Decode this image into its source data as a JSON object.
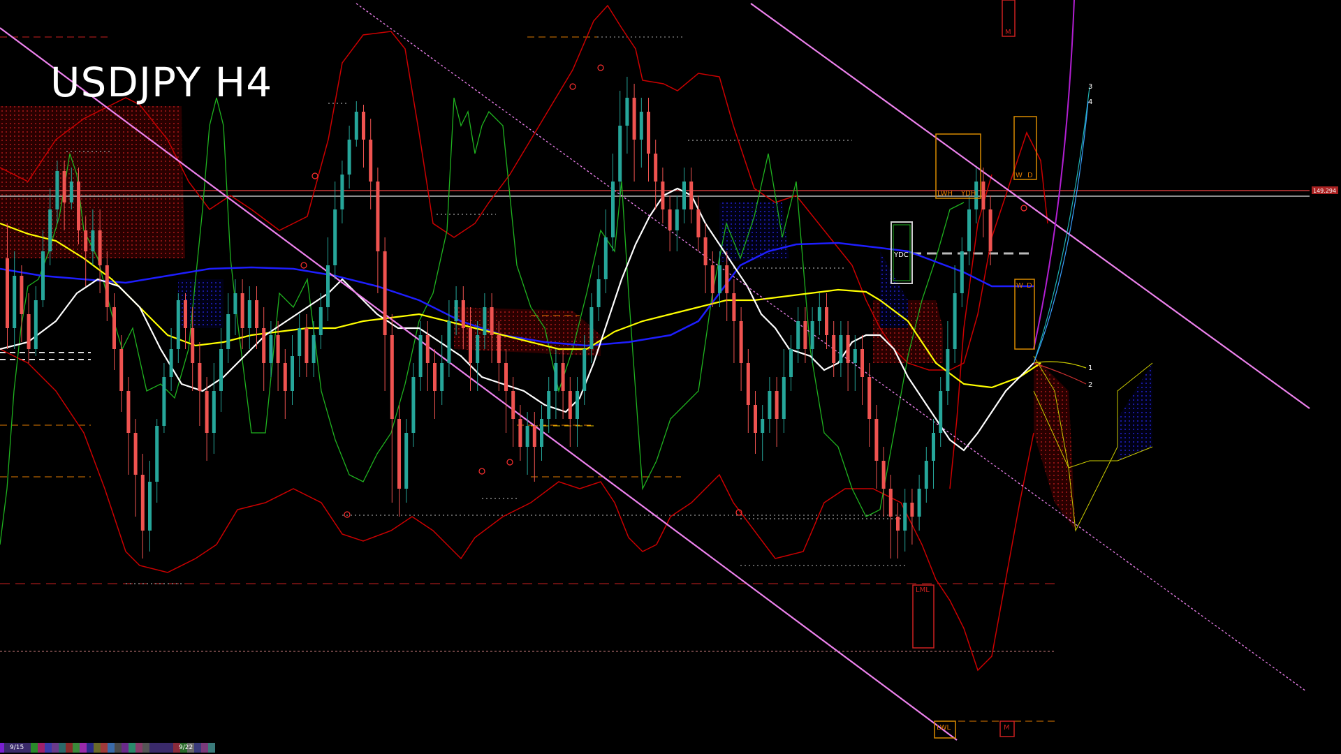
{
  "window": {
    "title": "USDJPY H4"
  },
  "colors": {
    "background": "#000000",
    "bull": "#26a69a",
    "bear": "#ef5350",
    "ma_white": "#ffffff",
    "ma_yellow": "#ffff00",
    "ma_blue": "#1e1eff",
    "bollinger": "#cc0000",
    "stoch": "#1fb31f",
    "channel": "#ee82ee",
    "parabolic": "#b21fd2",
    "cloud": "#b40000",
    "cloud_blue": "#1e1ecc",
    "box_orange": "#d98a00",
    "level_red": "#cc2020",
    "level_orange": "#e07a00"
  },
  "labels": {
    "ydc": "YDC",
    "lwh": "LWH",
    "ydh": "YDH",
    "w_top": "W",
    "d_top": "D",
    "w_mid": "W",
    "d_mid": "D",
    "m_top": "M",
    "m_bottom": "M",
    "lml": "LML",
    "lwl": "LWL",
    "price_tag": "149.294",
    "proj_1": "1",
    "proj_2": "2",
    "proj_3": "3",
    "proj_4": "4"
  },
  "timebar": {
    "date_1": "9/15",
    "date_2": "9/22"
  },
  "candles": [
    [
      370,
      470,
      320,
      500
    ],
    [
      470,
      395,
      360,
      500
    ],
    [
      395,
      450,
      380,
      490
    ],
    [
      450,
      500,
      420,
      520
    ],
    [
      500,
      430,
      410,
      510
    ],
    [
      430,
      360,
      330,
      440
    ],
    [
      360,
      300,
      270,
      380
    ],
    [
      300,
      245,
      230,
      320
    ],
    [
      245,
      290,
      230,
      330
    ],
    [
      290,
      260,
      240,
      300
    ],
    [
      260,
      330,
      240,
      350
    ],
    [
      330,
      360,
      310,
      410
    ],
    [
      360,
      330,
      300,
      380
    ],
    [
      330,
      380,
      300,
      420
    ],
    [
      380,
      440,
      360,
      460
    ],
    [
      440,
      500,
      420,
      530
    ],
    [
      500,
      560,
      480,
      590
    ],
    [
      560,
      620,
      540,
      680
    ],
    [
      620,
      680,
      600,
      740
    ],
    [
      680,
      760,
      650,
      800
    ],
    [
      760,
      690,
      660,
      790
    ],
    [
      690,
      610,
      600,
      720
    ],
    [
      610,
      540,
      520,
      620
    ],
    [
      540,
      500,
      470,
      560
    ],
    [
      500,
      430,
      420,
      520
    ],
    [
      430,
      470,
      420,
      500
    ],
    [
      470,
      520,
      440,
      560
    ],
    [
      520,
      560,
      490,
      610
    ],
    [
      560,
      620,
      540,
      660
    ],
    [
      620,
      560,
      520,
      650
    ],
    [
      560,
      500,
      470,
      590
    ],
    [
      500,
      450,
      420,
      520
    ],
    [
      450,
      420,
      400,
      480
    ],
    [
      420,
      470,
      400,
      500
    ],
    [
      470,
      430,
      410,
      500
    ],
    [
      430,
      470,
      410,
      500
    ],
    [
      470,
      520,
      440,
      560
    ],
    [
      520,
      480,
      460,
      540
    ],
    [
      480,
      520,
      460,
      560
    ],
    [
      520,
      560,
      500,
      600
    ],
    [
      560,
      510,
      480,
      580
    ],
    [
      510,
      470,
      450,
      540
    ],
    [
      470,
      520,
      450,
      540
    ],
    [
      520,
      480,
      460,
      540
    ],
    [
      480,
      440,
      420,
      500
    ],
    [
      440,
      380,
      340,
      460
    ],
    [
      380,
      300,
      260,
      400
    ],
    [
      300,
      250,
      230,
      320
    ],
    [
      250,
      200,
      180,
      270
    ],
    [
      200,
      160,
      145,
      210
    ],
    [
      160,
      200,
      150,
      240
    ],
    [
      200,
      260,
      170,
      300
    ],
    [
      260,
      360,
      240,
      420
    ],
    [
      360,
      480,
      340,
      560
    ],
    [
      480,
      600,
      450,
      720
    ],
    [
      600,
      700,
      580,
      740
    ],
    [
      700,
      620,
      600,
      720
    ],
    [
      620,
      540,
      520,
      640
    ],
    [
      540,
      480,
      460,
      560
    ],
    [
      480,
      520,
      460,
      560
    ],
    [
      520,
      560,
      500,
      600
    ],
    [
      560,
      520,
      480,
      580
    ],
    [
      520,
      460,
      430,
      540
    ],
    [
      460,
      430,
      410,
      480
    ],
    [
      430,
      470,
      410,
      500
    ],
    [
      470,
      520,
      440,
      560
    ],
    [
      520,
      480,
      460,
      560
    ],
    [
      480,
      440,
      420,
      500
    ],
    [
      440,
      480,
      420,
      520
    ],
    [
      480,
      520,
      460,
      560
    ],
    [
      520,
      560,
      500,
      620
    ],
    [
      560,
      600,
      540,
      640
    ],
    [
      600,
      640,
      580,
      660
    ],
    [
      640,
      610,
      590,
      680
    ],
    [
      610,
      640,
      590,
      690
    ],
    [
      640,
      600,
      580,
      660
    ],
    [
      600,
      560,
      540,
      620
    ],
    [
      560,
      520,
      500,
      600
    ],
    [
      520,
      560,
      500,
      600
    ],
    [
      560,
      600,
      540,
      640
    ],
    [
      600,
      560,
      540,
      640
    ],
    [
      560,
      500,
      480,
      580
    ],
    [
      500,
      440,
      420,
      520
    ],
    [
      440,
      400,
      380,
      460
    ],
    [
      400,
      340,
      300,
      420
    ],
    [
      340,
      260,
      220,
      360
    ],
    [
      260,
      180,
      130,
      280
    ],
    [
      180,
      140,
      110,
      220
    ],
    [
      140,
      200,
      120,
      260
    ],
    [
      200,
      160,
      140,
      240
    ],
    [
      160,
      220,
      140,
      260
    ],
    [
      220,
      260,
      200,
      300
    ],
    [
      260,
      300,
      240,
      320
    ],
    [
      300,
      330,
      280,
      360
    ],
    [
      330,
      300,
      280,
      360
    ],
    [
      300,
      260,
      240,
      320
    ],
    [
      260,
      300,
      240,
      320
    ],
    [
      300,
      340,
      280,
      360
    ],
    [
      340,
      380,
      320,
      420
    ],
    [
      380,
      420,
      360,
      440
    ],
    [
      420,
      380,
      360,
      440
    ],
    [
      380,
      420,
      360,
      460
    ],
    [
      420,
      460,
      400,
      520
    ],
    [
      460,
      520,
      440,
      560
    ],
    [
      520,
      580,
      500,
      620
    ],
    [
      580,
      620,
      560,
      650
    ],
    [
      620,
      600,
      580,
      660
    ],
    [
      600,
      560,
      540,
      620
    ],
    [
      560,
      600,
      540,
      640
    ],
    [
      600,
      540,
      500,
      620
    ],
    [
      540,
      500,
      480,
      560
    ],
    [
      500,
      460,
      440,
      520
    ],
    [
      460,
      500,
      440,
      520
    ],
    [
      500,
      460,
      440,
      520
    ],
    [
      460,
      440,
      420,
      480
    ],
    [
      440,
      480,
      420,
      500
    ],
    [
      480,
      520,
      460,
      540
    ],
    [
      520,
      480,
      460,
      540
    ],
    [
      480,
      520,
      460,
      560
    ],
    [
      520,
      500,
      480,
      560
    ],
    [
      500,
      540,
      480,
      580
    ],
    [
      540,
      600,
      520,
      640
    ],
    [
      600,
      660,
      580,
      700
    ],
    [
      660,
      700,
      640,
      740
    ],
    [
      700,
      740,
      680,
      800
    ],
    [
      740,
      760,
      720,
      800
    ],
    [
      760,
      720,
      700,
      790
    ],
    [
      720,
      740,
      700,
      780
    ],
    [
      740,
      700,
      680,
      760
    ],
    [
      700,
      660,
      640,
      720
    ],
    [
      660,
      620,
      600,
      700
    ],
    [
      620,
      560,
      540,
      640
    ],
    [
      560,
      500,
      460,
      580
    ],
    [
      500,
      420,
      380,
      520
    ],
    [
      420,
      360,
      340,
      440
    ],
    [
      360,
      300,
      280,
      380
    ],
    [
      300,
      260,
      240,
      320
    ],
    [
      260,
      300,
      240,
      340
    ],
    [
      300,
      360,
      280,
      380
    ]
  ],
  "projections": {
    "label_1": "1",
    "label_2": "2",
    "label_3": "3",
    "label_4": "4"
  }
}
